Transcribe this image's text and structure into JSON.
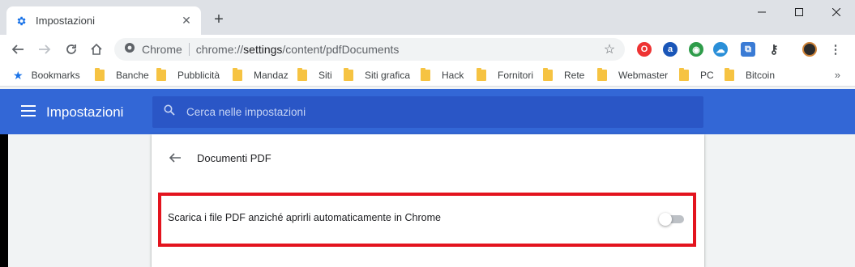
{
  "tab": {
    "title": "Impostazioni",
    "icon": "gear-icon"
  },
  "toolbar": {
    "site_label": "Chrome",
    "url_scheme": "chrome://",
    "url_host": "settings",
    "url_path": "/content/pdfDocuments"
  },
  "bookmarks": {
    "items": [
      {
        "label": "Bookmarks",
        "icon": "star-icon"
      },
      {
        "label": "Banche",
        "icon": "folder-icon"
      },
      {
        "label": "Pubblicità",
        "icon": "folder-icon"
      },
      {
        "label": "Mandaz",
        "icon": "folder-icon"
      },
      {
        "label": "Siti",
        "icon": "folder-icon"
      },
      {
        "label": "Siti grafica",
        "icon": "folder-icon"
      },
      {
        "label": "Hack",
        "icon": "folder-icon"
      },
      {
        "label": "Fornitori",
        "icon": "folder-icon"
      },
      {
        "label": "Rete",
        "icon": "folder-icon"
      },
      {
        "label": "Webmaster",
        "icon": "folder-icon"
      },
      {
        "label": "PC",
        "icon": "folder-icon"
      },
      {
        "label": "Bitcoin",
        "icon": "folder-icon"
      }
    ],
    "more": "»"
  },
  "settings": {
    "header_title": "Impostazioni",
    "search_placeholder": "Cerca nelle impostazioni",
    "section_title": "Documenti PDF",
    "option_label": "Scarica i file PDF anziché aprirli automaticamente in Chrome",
    "option_enabled": false
  },
  "colors": {
    "header_blue": "#3367d6",
    "search_blue": "#2a56c6",
    "highlight_red": "#e3141e",
    "folder_yellow": "#f6c342"
  }
}
